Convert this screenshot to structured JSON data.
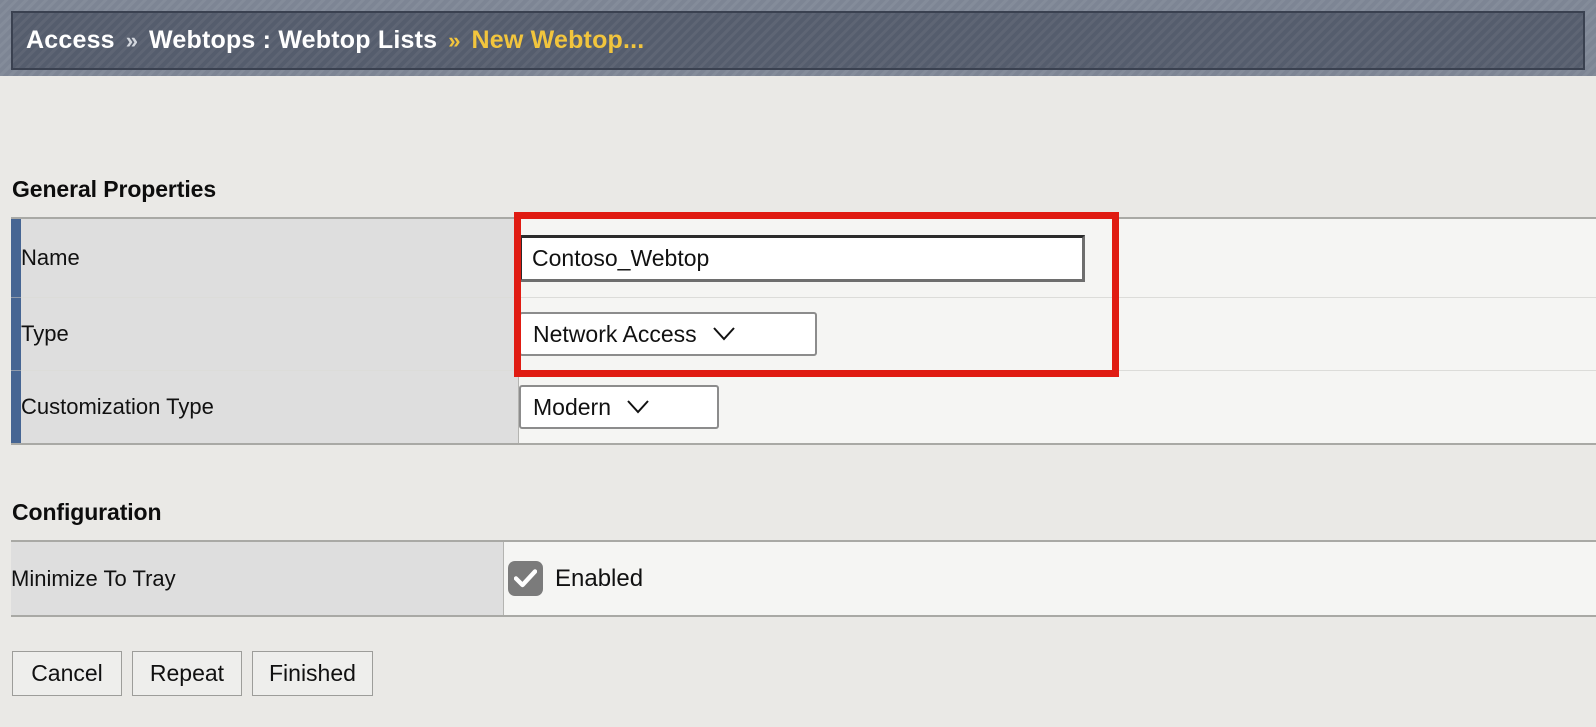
{
  "breadcrumb": {
    "segments": [
      "Access",
      "Webtops : Webtop Lists"
    ],
    "current": "New Webtop...",
    "separator": "»"
  },
  "sections": {
    "general_properties": {
      "title": "General Properties",
      "rows": [
        {
          "label": "Name",
          "control": "text",
          "value": "Contoso_Webtop",
          "placeholder": ""
        },
        {
          "label": "Type",
          "control": "select",
          "value": "Network Access"
        },
        {
          "label": "Customization Type",
          "control": "select",
          "value": "Modern"
        }
      ]
    },
    "configuration": {
      "title": "Configuration",
      "rows": [
        {
          "label": "Minimize To Tray",
          "control": "checkbox",
          "checked": true,
          "value": "Enabled"
        }
      ]
    }
  },
  "buttons": [
    {
      "label": "Cancel"
    },
    {
      "label": "Repeat"
    },
    {
      "label": "Finished"
    }
  ],
  "icons": {
    "chevron_down": "chevron-down-icon",
    "checkmark": "checkmark-icon"
  },
  "colors": {
    "accent_bar": "#466593",
    "highlight_box": "#e01b12",
    "breadcrumb_current": "#f2c53d",
    "breadcrumb_bar": "#555d6d",
    "page_background": "#eae9e6",
    "checkbox": "#7b7b7b"
  }
}
